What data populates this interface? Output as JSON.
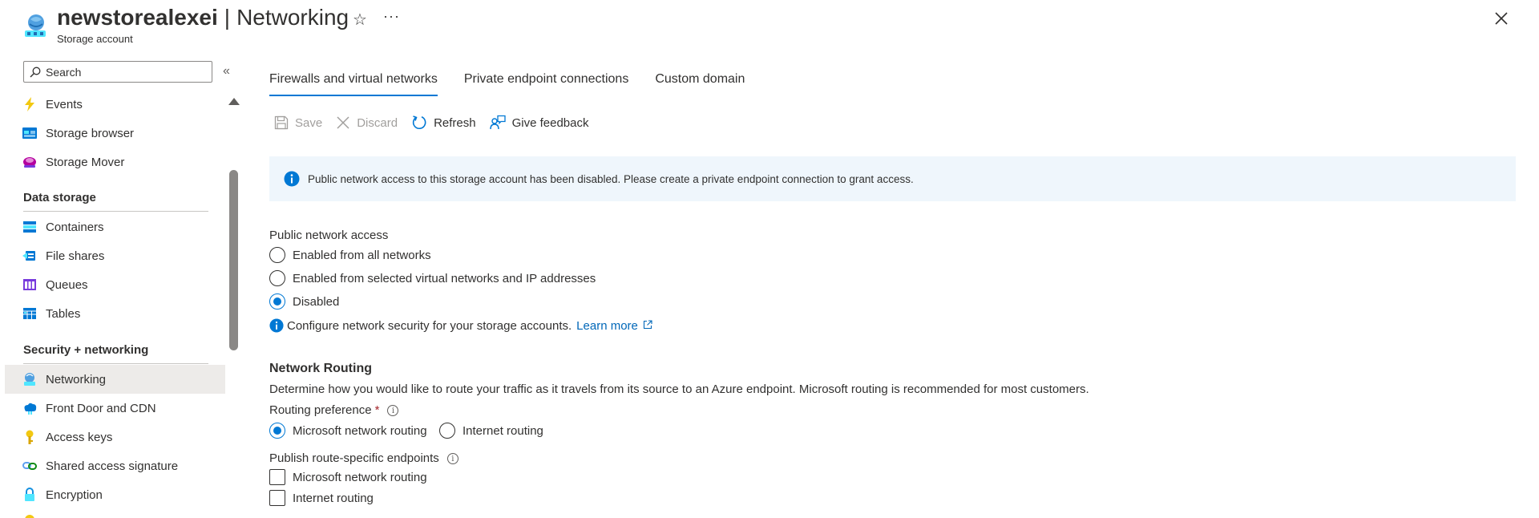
{
  "header": {
    "resource_name": "newstorealexei",
    "separator": "|",
    "page": "Networking",
    "subtitle": "Storage account",
    "star_icon": "star-icon",
    "more_label": "···",
    "close_icon": "close-icon"
  },
  "sidebar": {
    "search": {
      "placeholder": "Search",
      "value": ""
    },
    "collapse_label": "«",
    "items_top": [
      {
        "label": "Events",
        "icon": "lightning-icon"
      },
      {
        "label": "Storage browser",
        "icon": "storage-browser-icon"
      },
      {
        "label": "Storage Mover",
        "icon": "storage-mover-icon"
      }
    ],
    "section_data_storage": "Data storage",
    "items_data_storage": [
      {
        "label": "Containers",
        "icon": "containers-icon"
      },
      {
        "label": "File shares",
        "icon": "file-shares-icon"
      },
      {
        "label": "Queues",
        "icon": "queues-icon"
      },
      {
        "label": "Tables",
        "icon": "tables-icon"
      }
    ],
    "section_security": "Security + networking",
    "items_security": [
      {
        "label": "Networking",
        "icon": "networking-icon",
        "active": true
      },
      {
        "label": "Front Door and CDN",
        "icon": "front-door-icon"
      },
      {
        "label": "Access keys",
        "icon": "key-icon"
      },
      {
        "label": "Shared access signature",
        "icon": "link-icon"
      },
      {
        "label": "Encryption",
        "icon": "lock-icon"
      }
    ]
  },
  "tabs": [
    {
      "label": "Firewalls and virtual networks",
      "active": true
    },
    {
      "label": "Private endpoint connections",
      "active": false
    },
    {
      "label": "Custom domain",
      "active": false
    }
  ],
  "toolbar": {
    "save": "Save",
    "discard": "Discard",
    "refresh": "Refresh",
    "feedback": "Give feedback"
  },
  "banner": {
    "text": "Public network access to this storage account has been disabled. Please create a private endpoint connection to grant access."
  },
  "public_access": {
    "label": "Public network access",
    "options": [
      {
        "label": "Enabled from all networks",
        "checked": false
      },
      {
        "label": "Enabled from selected virtual networks and IP addresses",
        "checked": false
      },
      {
        "label": "Disabled",
        "checked": true
      }
    ],
    "hint": "Configure network security for your storage accounts.",
    "learn_more": "Learn more"
  },
  "routing": {
    "title": "Network Routing",
    "description": "Determine how you would like to route your traffic as it travels from its source to an Azure endpoint. Microsoft routing is recommended for most customers.",
    "preference_label": "Routing preference",
    "required_mark": "*",
    "preference_options": [
      {
        "label": "Microsoft network routing",
        "checked": true
      },
      {
        "label": "Internet routing",
        "checked": false
      }
    ],
    "publish_label": "Publish route-specific endpoints",
    "publish_options": [
      {
        "label": "Microsoft network routing",
        "checked": false
      },
      {
        "label": "Internet routing",
        "checked": false
      }
    ]
  },
  "colors": {
    "accent": "#0078d4",
    "banner_bg": "#eff6fc",
    "active_nav_bg": "#edebe9",
    "link": "#0067b8"
  }
}
